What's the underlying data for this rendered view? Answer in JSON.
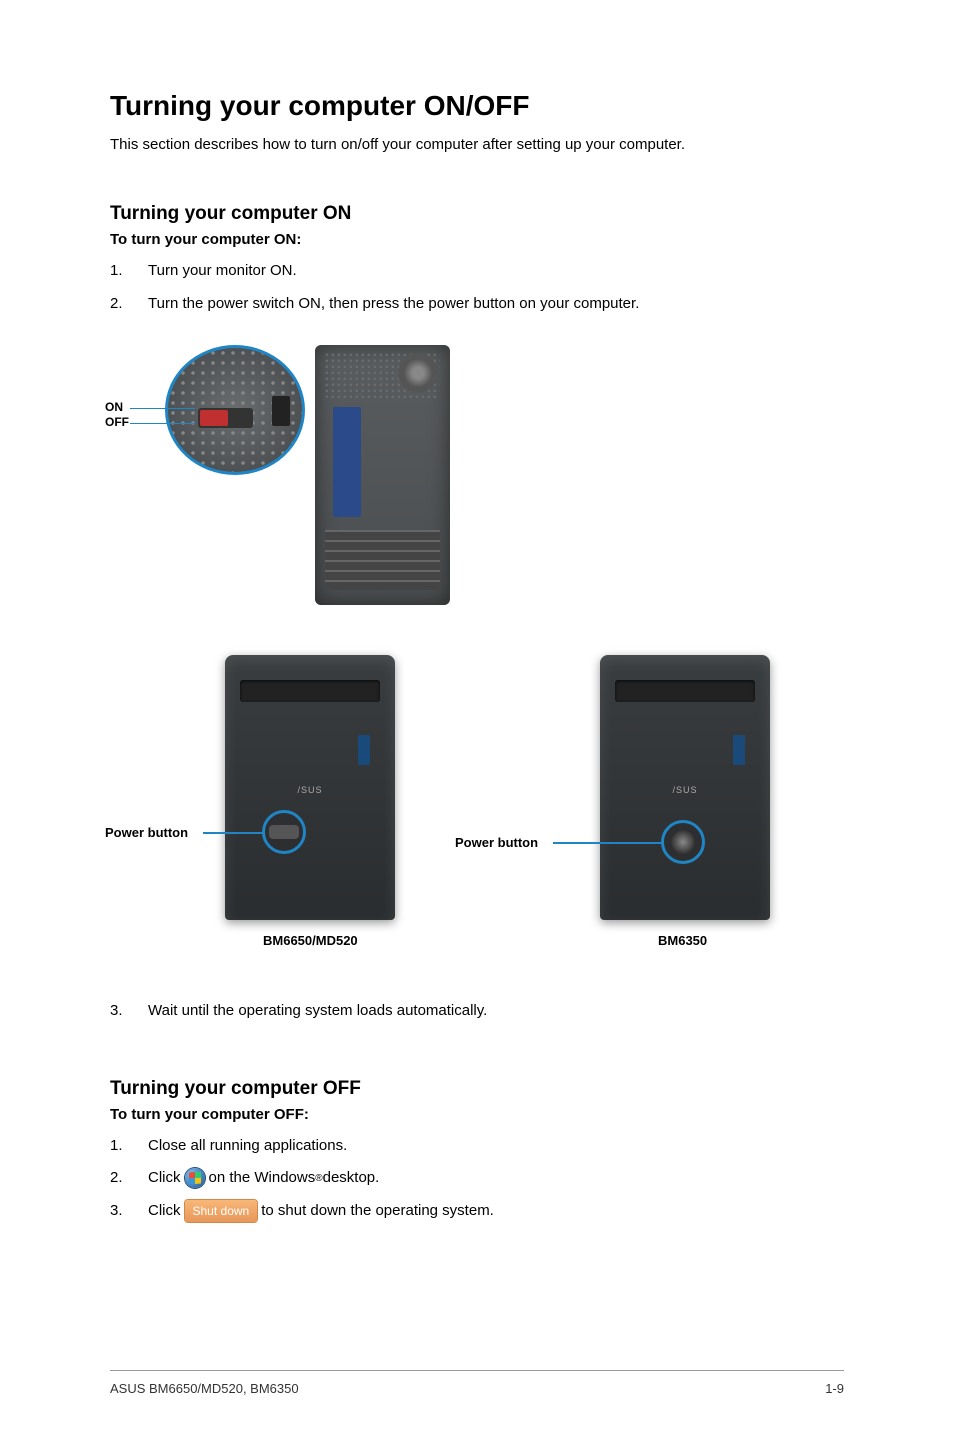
{
  "heading": "Turning your computer ON/OFF",
  "intro": "This section describes how to turn on/off your computer after setting up your computer.",
  "on_section": {
    "heading": "Turning your computer ON",
    "sublabel": "To turn your computer ON:",
    "steps": [
      {
        "num": "1.",
        "text": "Turn your monitor ON."
      },
      {
        "num": "2.",
        "text": "Turn the power switch ON, then press the power button on your computer."
      },
      {
        "num": "3.",
        "text": "Wait until the operating system loads automatically."
      }
    ]
  },
  "figure1": {
    "on": "ON",
    "off": "OFF"
  },
  "figure2": {
    "power_button": "Power button",
    "model1": "BM6650/MD520",
    "model2": "BM6350",
    "logo": "/SUS"
  },
  "off_section": {
    "heading": "Turning your computer OFF",
    "sublabel": "To turn your computer OFF:",
    "steps": {
      "s1": {
        "num": "1.",
        "text": "Close all running applications."
      },
      "s2": {
        "num": "2.",
        "pre": "Click",
        "post_a": " on the Windows",
        "post_b": " desktop."
      },
      "s3": {
        "num": "3.",
        "pre": "Click",
        "btn": "Shut down",
        "post": " to shut down the operating system."
      }
    },
    "reg": "®"
  },
  "footer": {
    "left": "ASUS BM6650/MD520, BM6350",
    "right": "1-9"
  }
}
